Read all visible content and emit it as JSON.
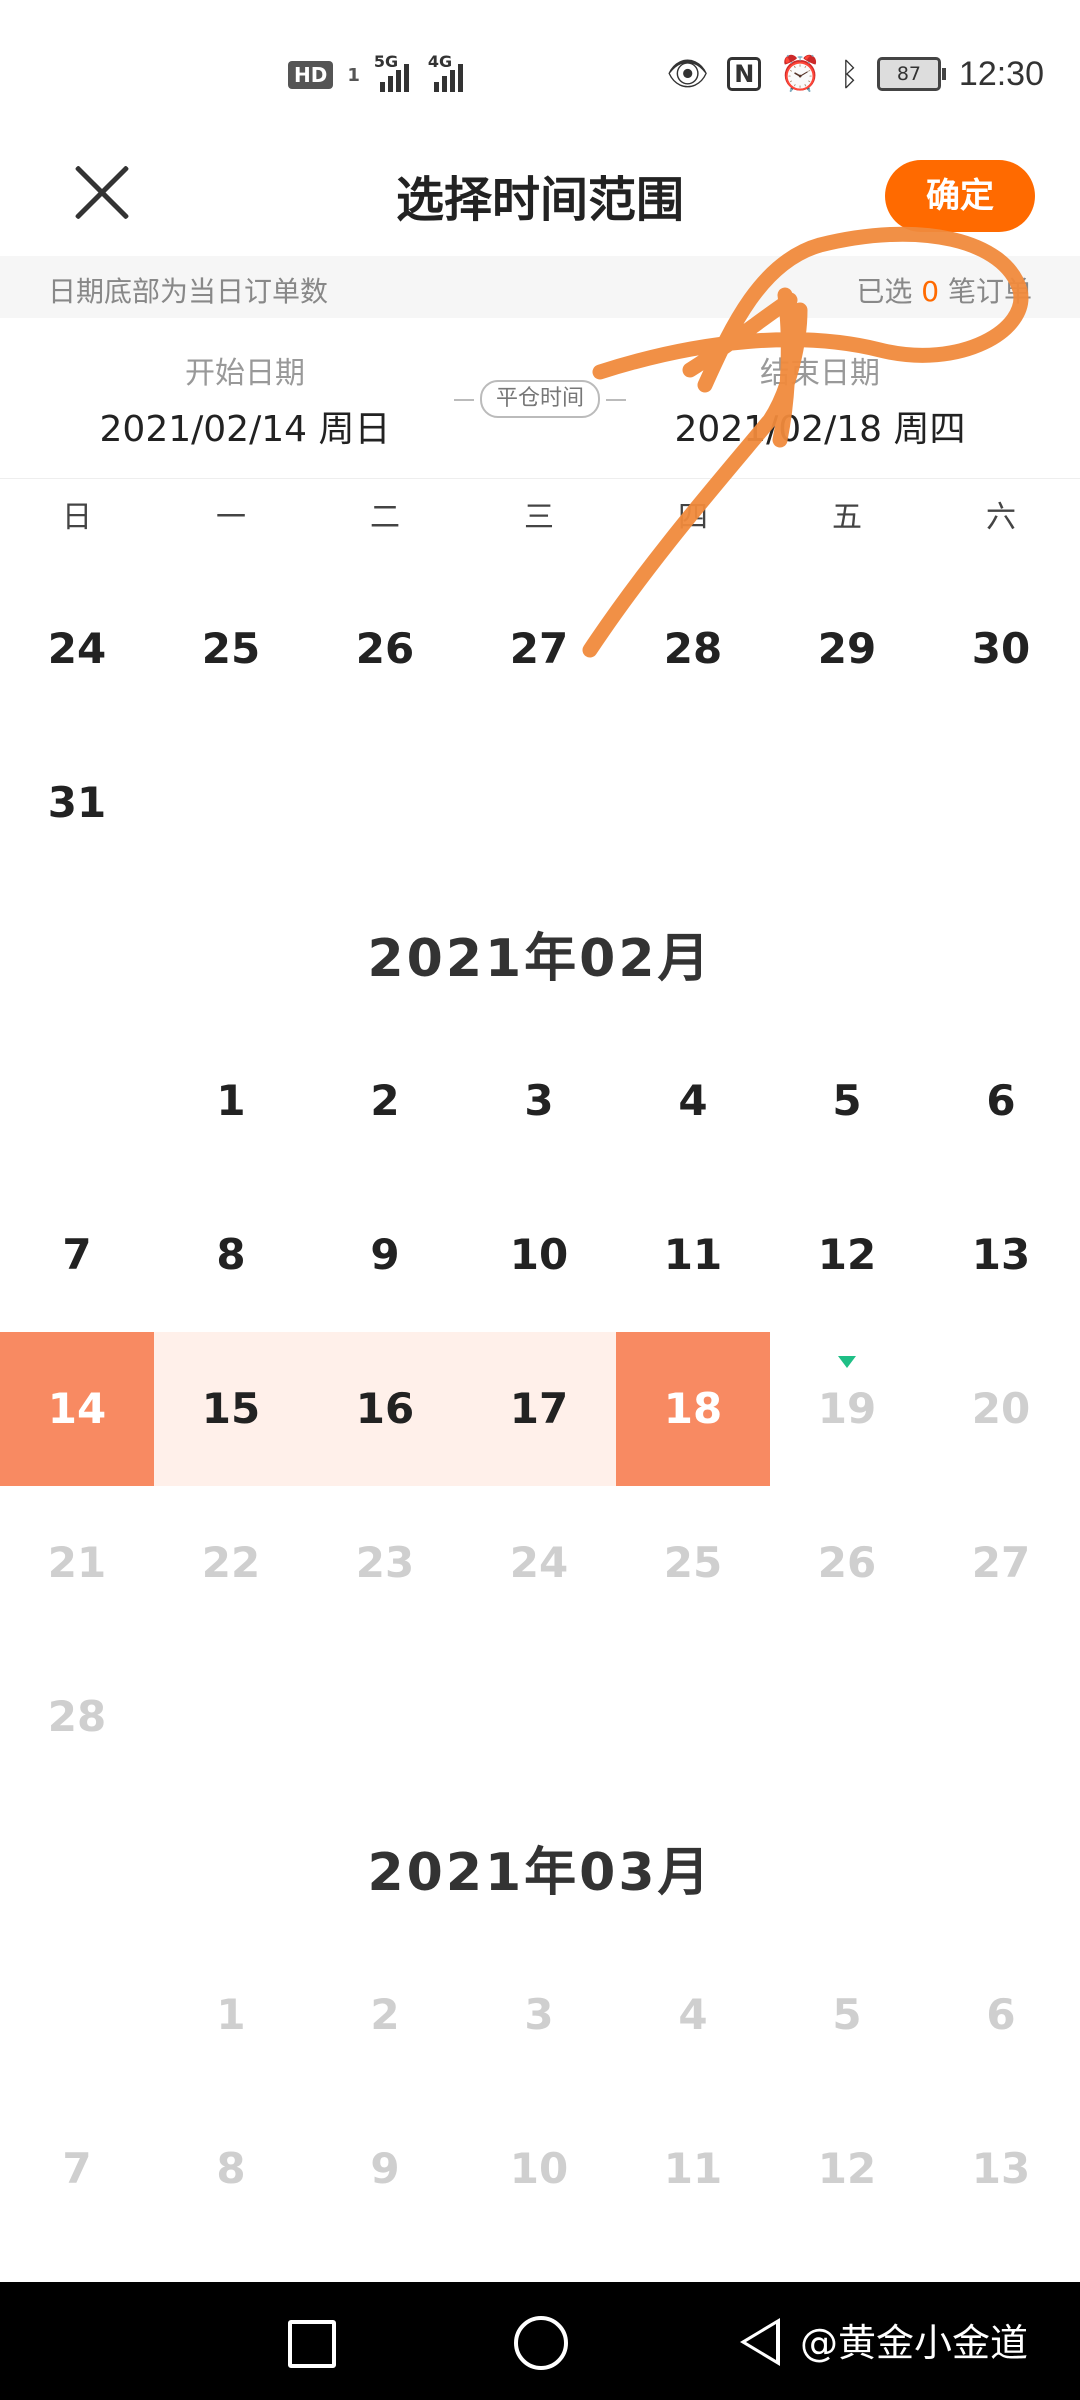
{
  "status_bar": {
    "hd_badge": "HD",
    "sim_slot": "1",
    "network_1": "5G",
    "network_2": "4G",
    "battery": "87",
    "time": "12:30"
  },
  "header": {
    "title": "选择时间范围",
    "confirm_label": "确定"
  },
  "hint": {
    "left_text": "日期底部为当日订单数",
    "selected_prefix": "已选",
    "selected_count": "0",
    "selected_suffix": "笔订单"
  },
  "range": {
    "start_label": "开始日期",
    "start_date": "2021/02/14 周日",
    "middle_label": "平仓时间",
    "end_label": "结束日期",
    "end_date": "2021/02/18 周四"
  },
  "weekdays": [
    "日",
    "一",
    "二",
    "三",
    "四",
    "五",
    "六"
  ],
  "january_tail": {
    "row1": [
      "24",
      "25",
      "26",
      "27",
      "28",
      "29",
      "30"
    ],
    "row2": [
      "31"
    ]
  },
  "february": {
    "title": "2021年02月",
    "rows": [
      [
        "",
        "1",
        "2",
        "3",
        "4",
        "5",
        "6"
      ],
      [
        "7",
        "8",
        "9",
        "10",
        "11",
        "12",
        "13"
      ],
      [
        "14",
        "15",
        "16",
        "17",
        "18",
        "19",
        "20"
      ],
      [
        "21",
        "22",
        "23",
        "24",
        "25",
        "26",
        "27"
      ],
      [
        "28"
      ]
    ],
    "range_start": "14",
    "range_end": "18",
    "today": "19"
  },
  "march": {
    "title": "2021年03月",
    "rows": [
      [
        "",
        "1",
        "2",
        "3",
        "4",
        "5",
        "6"
      ],
      [
        "7",
        "8",
        "9",
        "10",
        "11",
        "12",
        "13"
      ]
    ]
  },
  "watermark": "@黄金小金道",
  "colors": {
    "accent": "#ff6a00",
    "range_edge": "#f88a62",
    "range_fill": "#fff0ea",
    "today_marker": "#1fbf86",
    "scribble": "#f08a3c"
  }
}
